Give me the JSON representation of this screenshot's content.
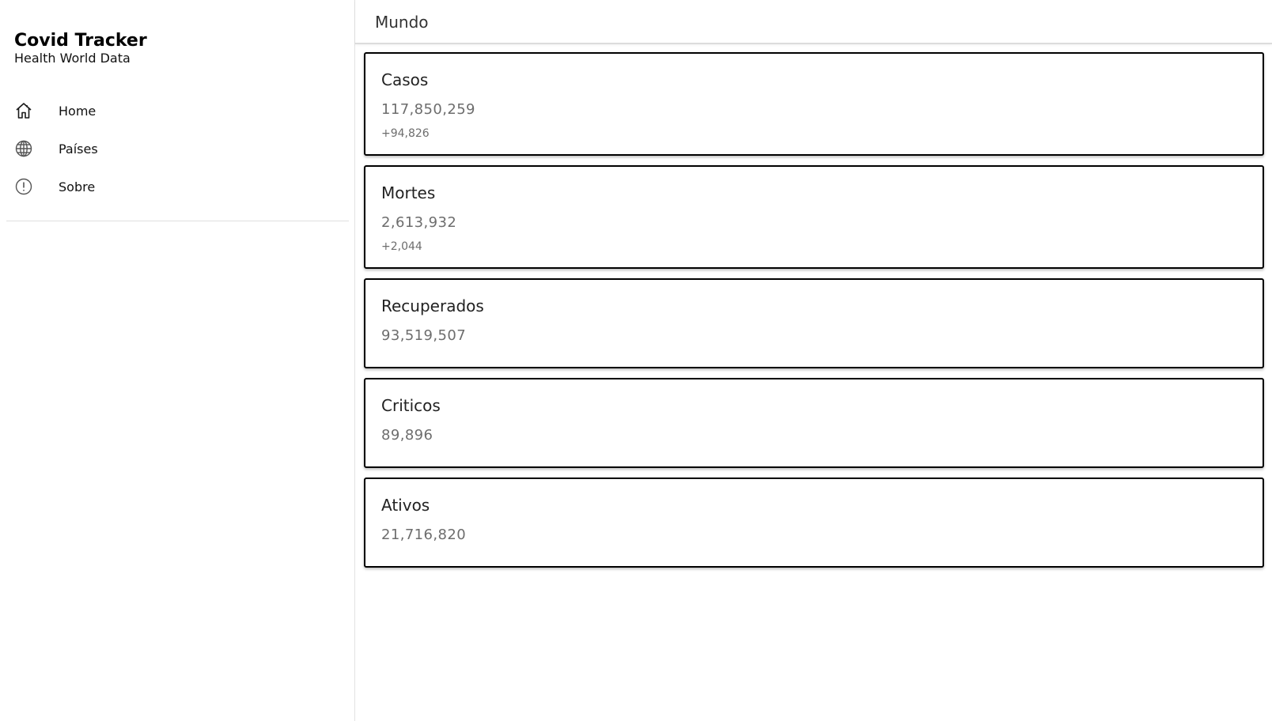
{
  "sidebar": {
    "brand": {
      "title": "Covid Tracker",
      "subtitle": "Health World Data"
    },
    "items": [
      {
        "label": "Home",
        "icon": "home-icon"
      },
      {
        "label": "Países",
        "icon": "globe-icon"
      },
      {
        "label": "Sobre",
        "icon": "info-icon"
      }
    ]
  },
  "header": {
    "title": "Mundo"
  },
  "cards": [
    {
      "title": "Casos",
      "value": "117,850,259",
      "delta": "+94,826"
    },
    {
      "title": "Mortes",
      "value": "2,613,932",
      "delta": "+2,044"
    },
    {
      "title": "Recuperados",
      "value": "93,519,507"
    },
    {
      "title": "Criticos",
      "value": "89,896"
    },
    {
      "title": "Ativos",
      "value": "21,716,820"
    }
  ],
  "colors": {
    "card_border": "#000000",
    "value_text": "#6d6d6d",
    "background": "#ffffff"
  }
}
